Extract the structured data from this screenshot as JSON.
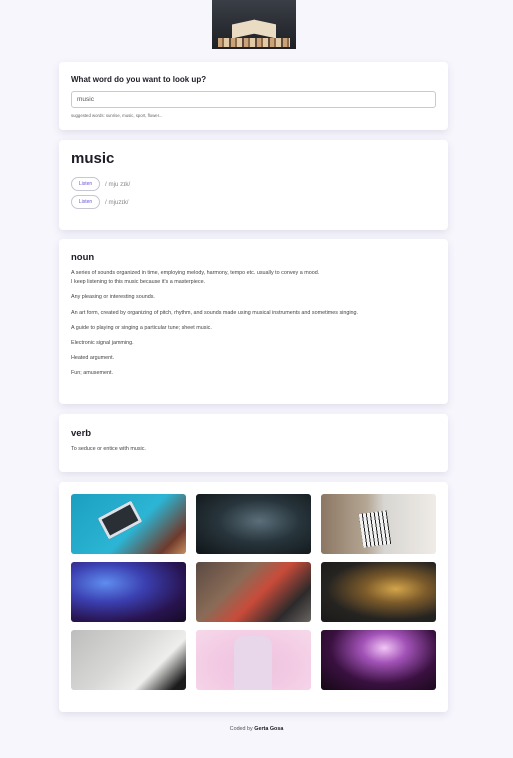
{
  "search": {
    "title": "What word do you want to look up?",
    "value": "music",
    "suggested": "suggested words: sunrise, music, sport, flower..."
  },
  "word": {
    "text": "music",
    "phonetics": [
      {
        "listen_label": "Listen",
        "text": "/ mju zɪk/"
      },
      {
        "listen_label": "Listen",
        "text": "/ mjuzɪk/"
      }
    ]
  },
  "meanings": [
    {
      "part_of_speech": "noun",
      "definitions": [
        {
          "text": "A series of sounds organized in time, employing melody, harmony, tempo etc. usually to convey a mood.",
          "example": "I keep listening to this music because it's a masterpiece."
        },
        {
          "text": "Any pleasing or interesting sounds."
        },
        {
          "text": "An art form, created by organizing of pitch, rhythm, and sounds made using musical instruments and sometimes singing."
        },
        {
          "text": "A guide to playing or singing a particular tune; sheet music."
        },
        {
          "text": "Electronic signal jamming."
        },
        {
          "text": "Heated argument."
        },
        {
          "text": "Fun; amusement."
        }
      ]
    },
    {
      "part_of_speech": "verb",
      "definitions": [
        {
          "text": "To seduce or entice with music."
        }
      ]
    }
  ],
  "gallery": {
    "images": [
      {
        "name": "cassette-tape-photo"
      },
      {
        "name": "singer-microphone-photo"
      },
      {
        "name": "keyboard-sheet-music-photo"
      },
      {
        "name": "concert-stage-lights-photo"
      },
      {
        "name": "band-playing-guitars-photo"
      },
      {
        "name": "saxophone-photo"
      },
      {
        "name": "sheet-music-photo"
      },
      {
        "name": "person-pink-background-photo"
      },
      {
        "name": "concert-crowd-photo"
      }
    ]
  },
  "footer": {
    "prefix": "Coded by",
    "author": "Gerta Gosa"
  }
}
